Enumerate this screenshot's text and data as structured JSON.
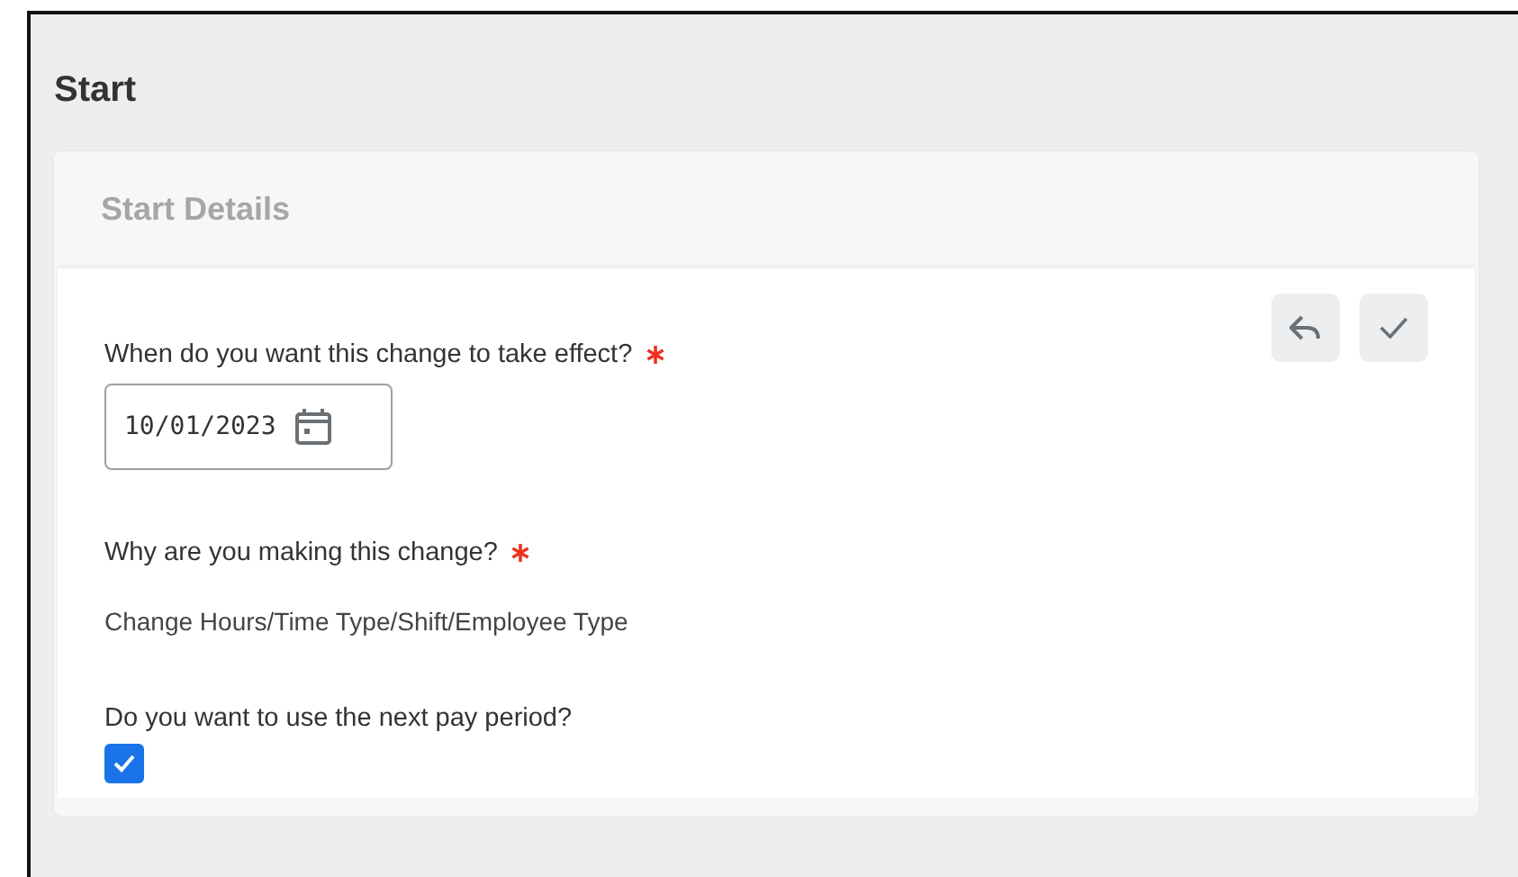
{
  "page_title": "Start",
  "card": {
    "title": "Start Details",
    "actions": [
      {
        "kind": "undo"
      },
      {
        "kind": "confirm"
      }
    ],
    "fields": [
      {
        "kind": "date",
        "label": "When do you want this change to take effect?",
        "required": true,
        "value": "10/01/2023"
      },
      {
        "kind": "text",
        "label": "Why are you making this change?",
        "required": true,
        "value": "Change Hours/Time Type/Shift/Employee Type"
      },
      {
        "kind": "checkbox",
        "label": "Do you want to use the next pay period?",
        "required": false,
        "checked": true
      }
    ]
  }
}
